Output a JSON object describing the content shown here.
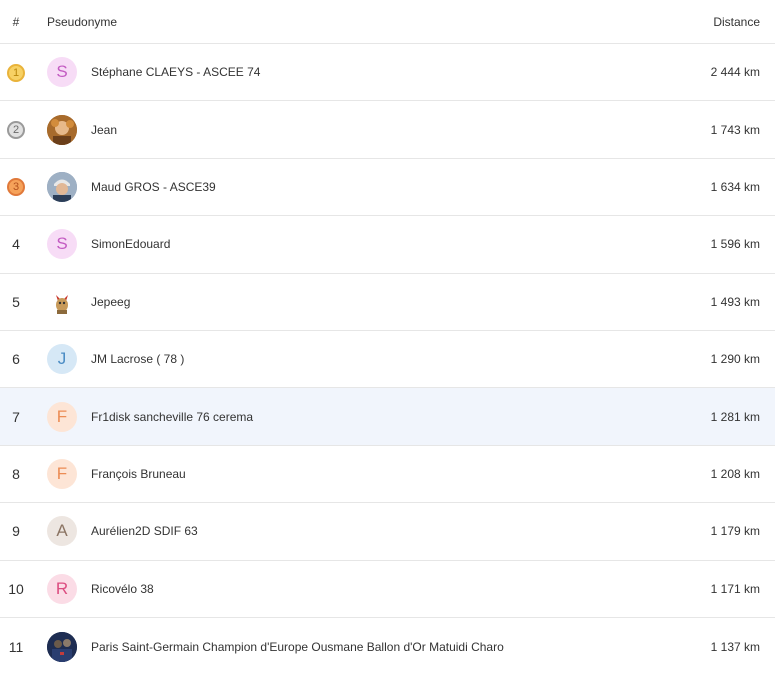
{
  "header": {
    "rank": "#",
    "pseudonyme": "Pseudonyme",
    "distance": "Distance"
  },
  "colors": {
    "highlight_row": "#f1f5fc",
    "border": "#e6e6e6"
  },
  "rows": [
    {
      "rank": "1",
      "medal": "gold",
      "initial": "S",
      "avatar_bg": "#f7dcf6",
      "avatar_fg": "#c35bc2",
      "name": "Stéphane CLAEYS - ASCEE 74",
      "distance": "2 444 km"
    },
    {
      "rank": "2",
      "medal": "silver",
      "initial": "",
      "avatar_type": "photo",
      "name": "Jean",
      "distance": "1 743 km"
    },
    {
      "rank": "3",
      "medal": "bronze",
      "initial": "",
      "avatar_type": "photo",
      "name": "Maud GROS - ASCE39",
      "distance": "1 634 km"
    },
    {
      "rank": "4",
      "initial": "S",
      "avatar_bg": "#f7dcf6",
      "avatar_fg": "#c35bc2",
      "name": "SimonEdouard",
      "distance": "1 596 km"
    },
    {
      "rank": "5",
      "initial": "",
      "avatar_type": "photo",
      "name": "Jepeeg",
      "distance": "1 493 km"
    },
    {
      "rank": "6",
      "initial": "J",
      "avatar_bg": "#d6e8f6",
      "avatar_fg": "#4a8cc4",
      "name": "JM Lacrose ( 78 )",
      "distance": "1 290 km"
    },
    {
      "rank": "7",
      "initial": "F",
      "avatar_bg": "#fde5d6",
      "avatar_fg": "#ec8c54",
      "name": "Fr1disk sancheville 76 cerema",
      "distance": "1 281 km",
      "highlight": true
    },
    {
      "rank": "8",
      "initial": "F",
      "avatar_bg": "#fde5d6",
      "avatar_fg": "#ec8c54",
      "name": "François Bruneau",
      "distance": "1 208 km"
    },
    {
      "rank": "9",
      "initial": "A",
      "avatar_bg": "#ede6e1",
      "avatar_fg": "#8c7564",
      "name": "Aurélien2D SDIF 63",
      "distance": "1 179 km"
    },
    {
      "rank": "10",
      "initial": "R",
      "avatar_bg": "#fbdce6",
      "avatar_fg": "#dc4d80",
      "name": "Ricovélo 38",
      "distance": "1 171 km"
    },
    {
      "rank": "11",
      "initial": "",
      "avatar_type": "photo",
      "name": "Paris Saint-Germain Champion d'Europe Ousmane Ballon d'Or Matuidi Charo",
      "distance": "1 137 km"
    }
  ],
  "icons": {
    "medal_1": "medal-gold-icon",
    "medal_2": "medal-silver-icon",
    "medal_3": "medal-bronze-icon"
  }
}
